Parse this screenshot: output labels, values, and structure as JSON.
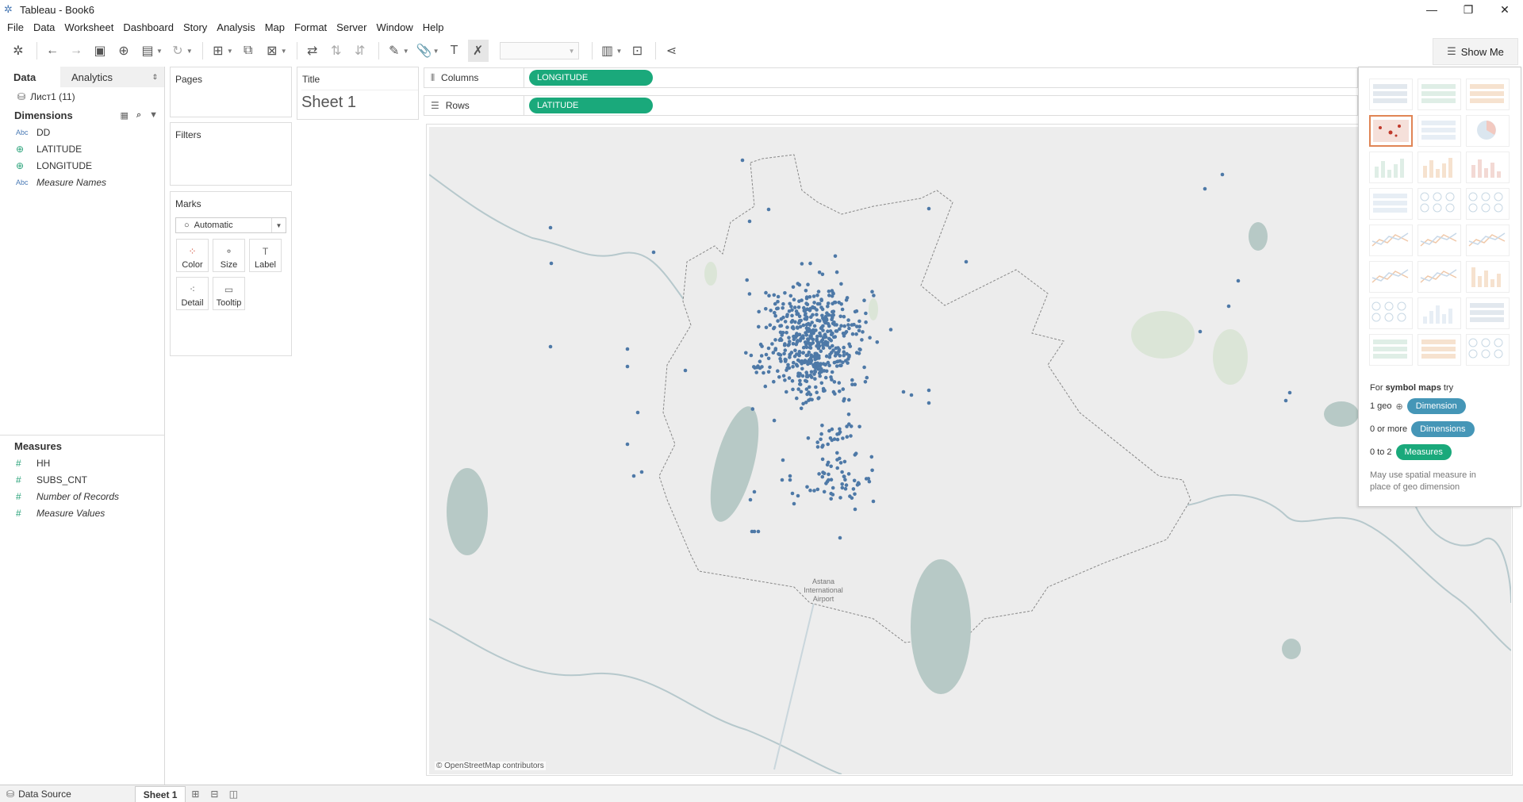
{
  "window": {
    "title": "Tableau - Book6",
    "minimize": "—",
    "restore": "❐",
    "close": "✕"
  },
  "menu": [
    "File",
    "Data",
    "Worksheet",
    "Dashboard",
    "Story",
    "Analysis",
    "Map",
    "Format",
    "Server",
    "Window",
    "Help"
  ],
  "toolbar": {
    "show_me_label": "Show Me"
  },
  "data_pane": {
    "tab_data": "Data",
    "tab_analytics": "Analytics",
    "source": "Лист1 (11)",
    "dimensions_header": "Dimensions",
    "dimensions": [
      {
        "type": "Abc",
        "name": "DD"
      },
      {
        "type": "geo",
        "name": "LATITUDE"
      },
      {
        "type": "geo",
        "name": "LONGITUDE"
      },
      {
        "type": "Abc",
        "name": "Measure Names"
      }
    ],
    "measures_header": "Measures",
    "measures": [
      {
        "name": "HH"
      },
      {
        "name": "SUBS_CNT"
      },
      {
        "name": "Number of Records"
      },
      {
        "name": "Measure Values"
      }
    ]
  },
  "cards": {
    "pages": "Pages",
    "filters": "Filters",
    "marks": "Marks",
    "marks_type": "Automatic",
    "mark_buttons": [
      "Color",
      "Size",
      "Label",
      "Detail",
      "Tooltip"
    ],
    "title_card": "Title",
    "sheet_title": "Sheet 1"
  },
  "shelves": {
    "columns_label": "Columns",
    "columns_pill": "LONGITUDE",
    "rows_label": "Rows",
    "rows_pill": "LATITUDE"
  },
  "map": {
    "attribution": "© OpenStreetMap contributors",
    "airport_label_1": "Astana",
    "airport_label_2": "International",
    "airport_label_3": "Airport",
    "point_color": "#4e79a7"
  },
  "show_me": {
    "hint_prefix": "For ",
    "hint_bold": "symbol maps",
    "hint_suffix": " try",
    "row1_label": "1 geo",
    "row1_pill": "Dimension",
    "row2_label": "0 or more",
    "row2_pill": "Dimensions",
    "row3_label": "0 to 2",
    "row3_pill": "Measures",
    "note": "May use spatial measure in place of geo dimension",
    "dimension_color": "#4596b7",
    "measure_color": "#1aa97b"
  },
  "bottom_tabs": {
    "data_source": "Data Source",
    "sheet": "Sheet 1"
  }
}
